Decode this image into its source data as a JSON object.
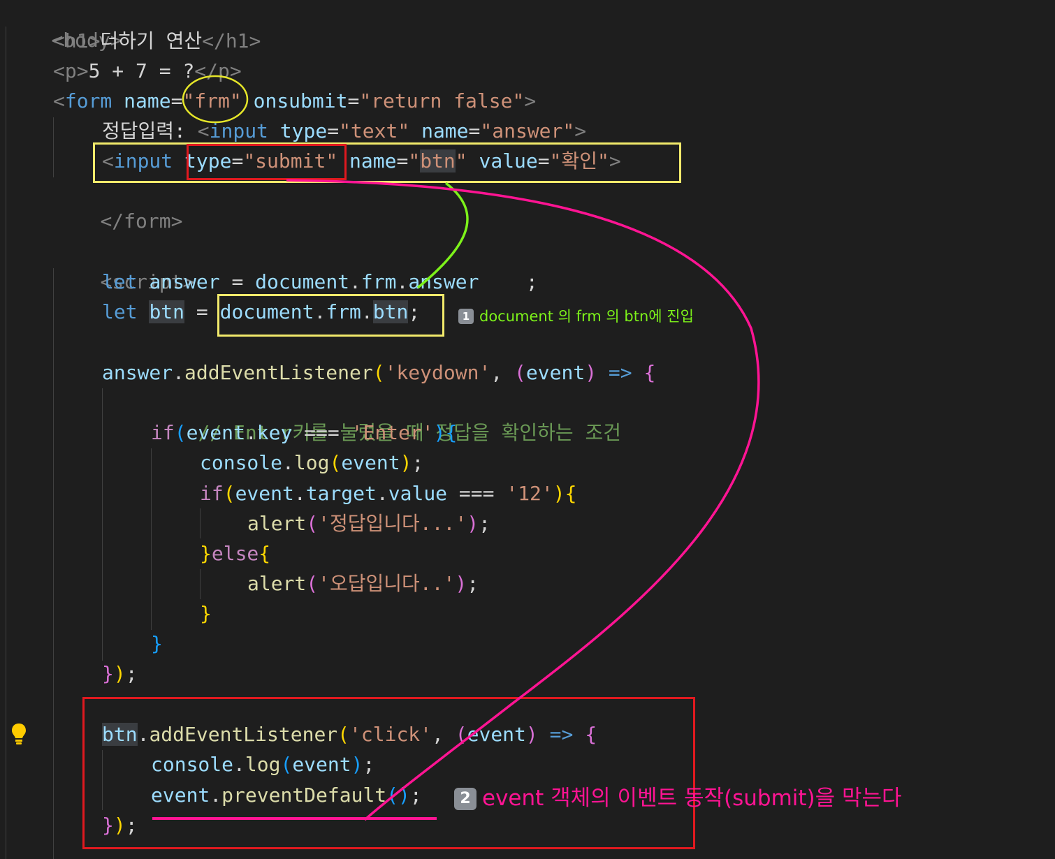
{
  "code": {
    "body_open": "<body>",
    "h1_open": "<h1>",
    "h1_text": "더하기 연산",
    "h1_close": "</h1>",
    "p_open": "<p>",
    "p_text": "5 + 7 = ?",
    "p_close": "</p>",
    "form_tag": "form",
    "form_name_attr": "name",
    "form_name_val": "\"frm\"",
    "form_onsubmit_attr": "onsubmit",
    "form_onsubmit_val": "\"return false\"",
    "label_text": "정답입력: ",
    "input_tag": "input",
    "type_attr": "type",
    "type_text_val": "\"text\"",
    "name_attr": "name",
    "name_answer_val": "\"answer\"",
    "type_submit_val": "\"submit\"",
    "name_btn_val_q1": "\"",
    "name_btn_val_core": "btn",
    "name_btn_val_q2": "\"",
    "value_attr": "value",
    "value_val": "\"확인\"",
    "form_close": "</form>",
    "script_open": "<script>",
    "kw_let": "let",
    "var_answer": "answer",
    "var_btn": "btn",
    "var_document": "document",
    "var_frm": "frm",
    "var_event": "event",
    "prop_key": "key",
    "prop_target": "target",
    "prop_value": "value",
    "var_console": "console",
    "fn_addEventListener": "addEventListener",
    "fn_log": "log",
    "fn_alert": "alert",
    "fn_preventDefault": "preventDefault",
    "str_keydown": "'keydown'",
    "str_enter": "'Enter'",
    "str_12": "'12'",
    "str_correct": "'정답입니다...'",
    "str_wrong": "'오답입니다..'",
    "str_click": "'click'",
    "comment_enter": "// Enter키를 눌렀을 때 정답을 확인하는 조건",
    "kw_if": "if",
    "kw_else": "else",
    "op_assign": " = ",
    "op_strict_eq": " === ",
    "op_arrow": " => "
  },
  "annotations": {
    "note1_badge": "1",
    "note1_text": "document 의 frm 의 btn에 진입",
    "note2_badge": "2",
    "note2_text": "event 객체의 이벤트 동작(submit)을 막는다"
  },
  "colors": {
    "editor_bg": "#1e1e1e",
    "circle_yellow": "#e6e629",
    "box_yellow": "#f2ea6b",
    "box_red": "#e0191f",
    "arrow_green": "#7df21a",
    "arrow_pink": "#ff1493",
    "note1_color": "#7df21a",
    "note2_color": "#ff1493"
  }
}
